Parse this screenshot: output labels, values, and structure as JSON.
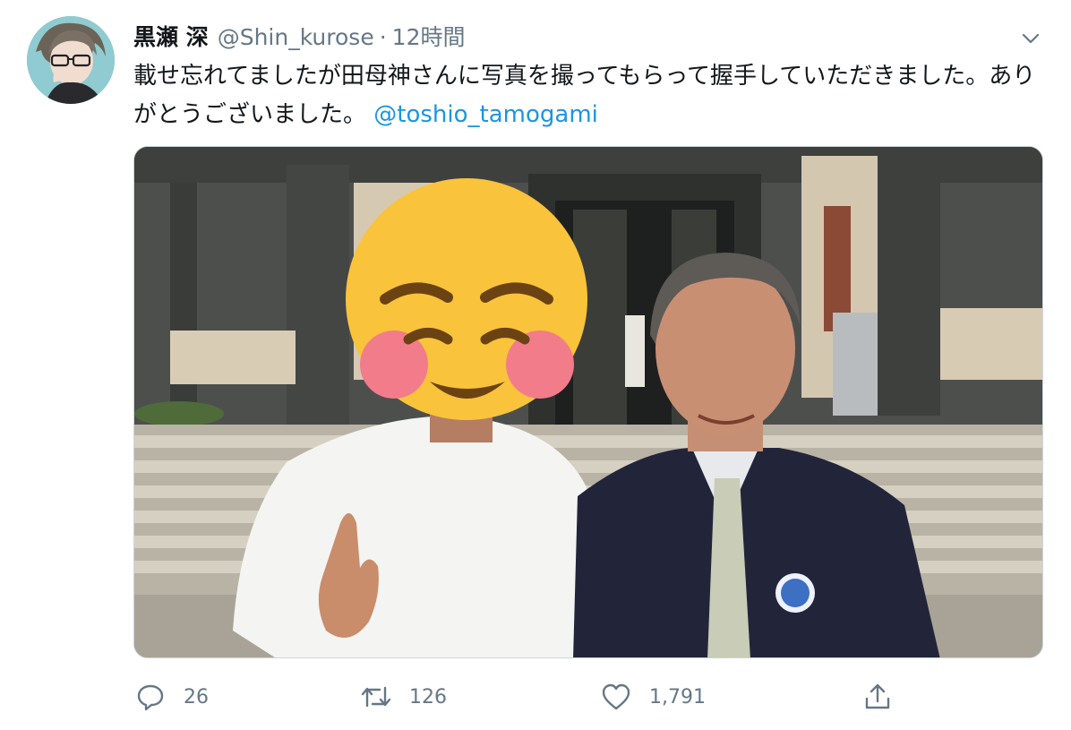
{
  "tweet": {
    "display_name": "黒瀬 深",
    "handle": "@Shin_kurose",
    "separator": "·",
    "time": "12時間",
    "text": "載せ忘れてましたが田母神さんに写真を撮ってもらって握手していただきました。ありがとうございました。",
    "mention": "@toshio_tamogami"
  },
  "actions": {
    "reply_count": "26",
    "retweet_count": "126",
    "like_count": "1,791"
  },
  "icons": {
    "reply": "reply-icon",
    "retweet": "retweet-icon",
    "like": "heart-icon",
    "share": "share-icon",
    "caret": "chevron-down-icon"
  },
  "colors": {
    "link": "#1b95e0",
    "secondary_text": "#657786",
    "primary_text": "#14171a"
  }
}
